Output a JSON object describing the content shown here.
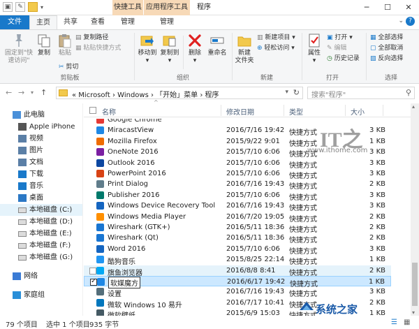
{
  "titlebar": {
    "contextual_tab_1": "快捷工具",
    "contextual_tab_2": "应用程序工具",
    "window_title": "程序"
  },
  "tabs": {
    "file": "文件",
    "home": "主页",
    "share": "共享",
    "view": "查看",
    "manage1": "管理",
    "manage2": "管理"
  },
  "ribbon": {
    "pin": "固定到\"快\n速访问\"",
    "copy": "复制",
    "paste": "粘贴",
    "copy_path": "复制路径",
    "paste_shortcut": "粘贴快捷方式",
    "cut": "剪切",
    "clipboard_group": "剪贴板",
    "move_to": "移动到",
    "copy_to": "复制到",
    "delete": "删除",
    "rename": "重命名",
    "organize_group": "组织",
    "new_folder": "新建\n文件夹",
    "new_item": "新建项目",
    "easy_access": "轻松访问",
    "new_group": "新建",
    "properties": "属性",
    "open": "打开",
    "edit": "编辑",
    "history": "历史记录",
    "open_group": "打开",
    "select_all": "全部选择",
    "select_none": "全部取消",
    "invert_selection": "反向选择",
    "select_group": "选择"
  },
  "address": {
    "crumbs": "«  Microsoft  ›  Windows  ›  「开始」菜单  ›  程序",
    "search_placeholder": "搜索\"程序\""
  },
  "nav": [
    {
      "label": "此电脑",
      "icon": "computer-icon"
    },
    {
      "label": "Apple iPhone",
      "icon": "phone-icon"
    },
    {
      "label": "视频",
      "icon": "video-folder-icon"
    },
    {
      "label": "图片",
      "icon": "pictures-folder-icon"
    },
    {
      "label": "文档",
      "icon": "documents-folder-icon"
    },
    {
      "label": "下载",
      "icon": "downloads-folder-icon"
    },
    {
      "label": "音乐",
      "icon": "music-folder-icon"
    },
    {
      "label": "桌面",
      "icon": "desktop-folder-icon"
    },
    {
      "label": "本地磁盘 (C:)",
      "icon": "drive-icon"
    },
    {
      "label": "本地磁盘 (D:)",
      "icon": "drive-icon"
    },
    {
      "label": "本地磁盘 (E:)",
      "icon": "drive-icon"
    },
    {
      "label": "本地磁盘 (F:)",
      "icon": "drive-icon"
    },
    {
      "label": "本地磁盘 (G:)",
      "icon": "drive-icon"
    },
    {
      "label": "网络",
      "icon": "network-icon"
    },
    {
      "label": "家庭组",
      "icon": "homegroup-icon"
    }
  ],
  "columns": {
    "name": "名称",
    "date": "修改日期",
    "type": "类型",
    "size": "大小"
  },
  "files": [
    {
      "name": "Google Chrome",
      "date": "",
      "type": "",
      "size": "",
      "color": "#e53935"
    },
    {
      "name": "MiracastView",
      "date": "2016/7/16 19:42",
      "type": "快捷方式",
      "size": "3 KB",
      "color": "#1e88e5"
    },
    {
      "name": "Mozilla Firefox",
      "date": "2015/9/22 9:01",
      "type": "快捷方式",
      "size": "1 KB",
      "color": "#ef6c00"
    },
    {
      "name": "OneNote 2016",
      "date": "2015/7/10 6:06",
      "type": "快捷方式",
      "size": "3 KB",
      "color": "#7b1fa2"
    },
    {
      "name": "Outlook 2016",
      "date": "2015/7/10 6:06",
      "type": "快捷方式",
      "size": "3 KB",
      "color": "#0d47a1"
    },
    {
      "name": "PowerPoint 2016",
      "date": "2015/7/10 6:06",
      "type": "快捷方式",
      "size": "3 KB",
      "color": "#d84315"
    },
    {
      "name": "Print Dialog",
      "date": "2016/7/16 19:43",
      "type": "快捷方式",
      "size": "2 KB",
      "color": "#607d8b"
    },
    {
      "name": "Publisher 2016",
      "date": "2015/7/10 6:06",
      "type": "快捷方式",
      "size": "3 KB",
      "color": "#00796b"
    },
    {
      "name": "Windows Device Recovery Tool",
      "date": "2016/7/16 19:43",
      "type": "快捷方式",
      "size": "3 KB",
      "color": "#1565c0"
    },
    {
      "name": "Windows Media Player",
      "date": "2016/7/20 19:05",
      "type": "快捷方式",
      "size": "2 KB",
      "color": "#ff8f00"
    },
    {
      "name": "Wireshark (GTK+)",
      "date": "2016/5/11 18:36",
      "type": "快捷方式",
      "size": "2 KB",
      "color": "#1976d2"
    },
    {
      "name": "Wireshark (Qt)",
      "date": "2016/5/11 18:36",
      "type": "快捷方式",
      "size": "2 KB",
      "color": "#1976d2"
    },
    {
      "name": "Word 2016",
      "date": "2015/7/10 6:06",
      "type": "快捷方式",
      "size": "3 KB",
      "color": "#1565c0"
    },
    {
      "name": "酷狗音乐",
      "date": "2015/8/25 22:14",
      "type": "快捷方式",
      "size": "1 KB",
      "color": "#2196f3"
    },
    {
      "name": "旗鱼浏览器",
      "date": "2016/8/8 8:41",
      "type": "快捷方式",
      "size": "2 KB",
      "color": "#03a9f4"
    },
    {
      "name": "软媒魔方",
      "date": "2016/6/17 19:42",
      "type": "快捷方式",
      "size": "1 KB",
      "color": "#1e88e5"
    },
    {
      "name": "设置",
      "date": "2016/7/16 19:43",
      "type": "快捷方式",
      "size": "3 KB",
      "color": "#546e7a"
    },
    {
      "name": "微软 Windows 10 易升",
      "date": "2016/7/17 10:41",
      "type": "快捷方式",
      "size": "2 KB",
      "color": "#0277bd"
    },
    {
      "name": "微软壁纸",
      "date": "2015/6/9 15:03",
      "type": "快捷方式",
      "size": "1 KB",
      "color": "#455a64"
    }
  ],
  "status": {
    "count": "79 个项目",
    "selected": "选中 1 个项目",
    "size": "935 字节"
  },
  "watermark": {
    "it": "IT之",
    "url": "www.ithome.com",
    "site": "系统之家"
  }
}
